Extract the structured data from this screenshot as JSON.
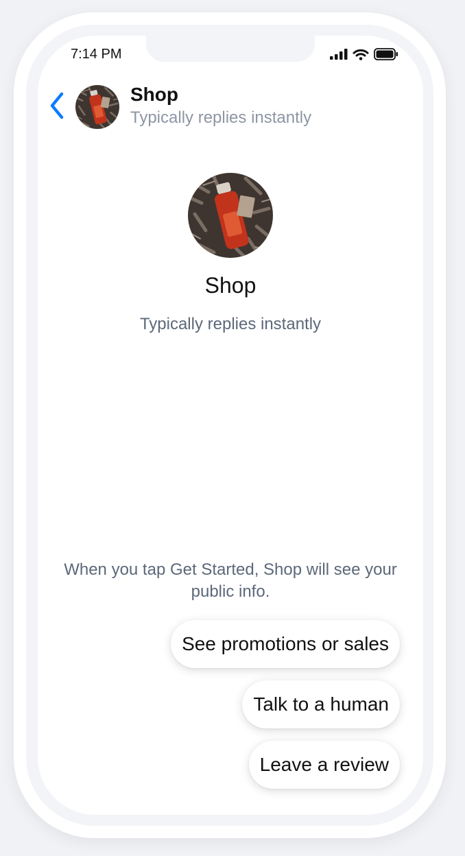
{
  "status_bar": {
    "time": "7:14 PM",
    "icons": [
      "cellular-signal-icon",
      "wifi-icon",
      "battery-icon"
    ]
  },
  "header": {
    "back_icon": "chevron-left-icon",
    "title": "Shop",
    "subtitle": "Typically replies instantly"
  },
  "profile": {
    "name": "Shop",
    "subtitle": "Typically replies instantly"
  },
  "notice": "When you tap Get Started, Shop will see your public info.",
  "quick_replies": [
    "See promotions or sales",
    "Talk to a human",
    "Leave a review"
  ],
  "colors": {
    "accent": "#0a7cff",
    "secondary_text": "#5c6879",
    "header_subtitle": "#8d96a4"
  }
}
